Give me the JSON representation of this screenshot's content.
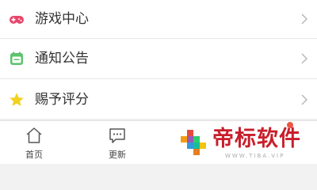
{
  "menu": {
    "items": [
      {
        "label": "游戏中心",
        "icon": "gamepad-icon",
        "color": "#e8476b"
      },
      {
        "label": "通知公告",
        "icon": "calendar-icon",
        "color": "#5cc36b"
      },
      {
        "label": "赐予评分",
        "icon": "star-icon",
        "color": "#f2d21f"
      }
    ]
  },
  "tabbar": {
    "tabs": [
      {
        "label": "首页",
        "icon": "home-icon"
      },
      {
        "label": "更新",
        "icon": "message-icon"
      }
    ]
  },
  "watermark": {
    "text": "帝标软件",
    "sub": "WWW.TIBA.VIP",
    "brand_color": "#c81e2b"
  }
}
